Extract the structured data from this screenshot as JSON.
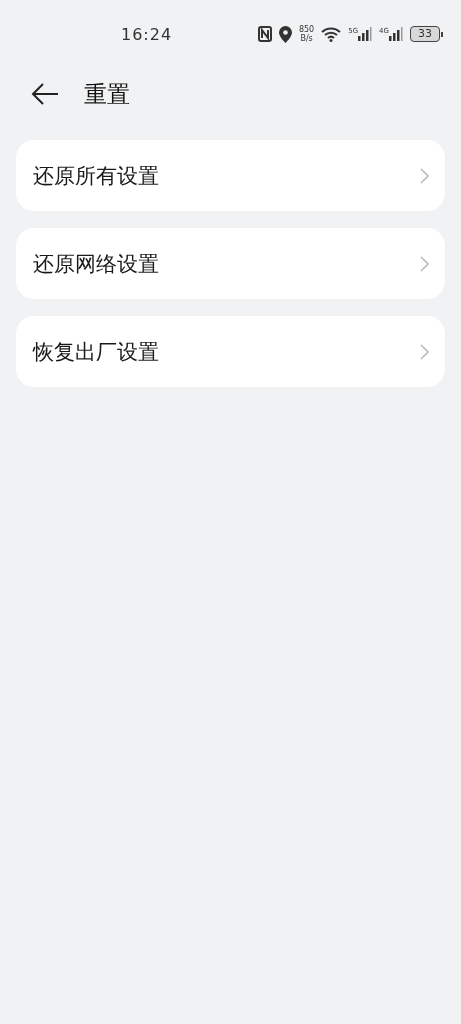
{
  "status_bar": {
    "time": "16:24",
    "speed": "850",
    "speed_unit": "B/s",
    "signal_1": "5G",
    "signal_2": "4G",
    "battery": "33"
  },
  "header": {
    "title": "重置"
  },
  "items": [
    {
      "label": "还原所有设置"
    },
    {
      "label": "还原网络设置"
    },
    {
      "label": "恢复出厂设置"
    }
  ]
}
